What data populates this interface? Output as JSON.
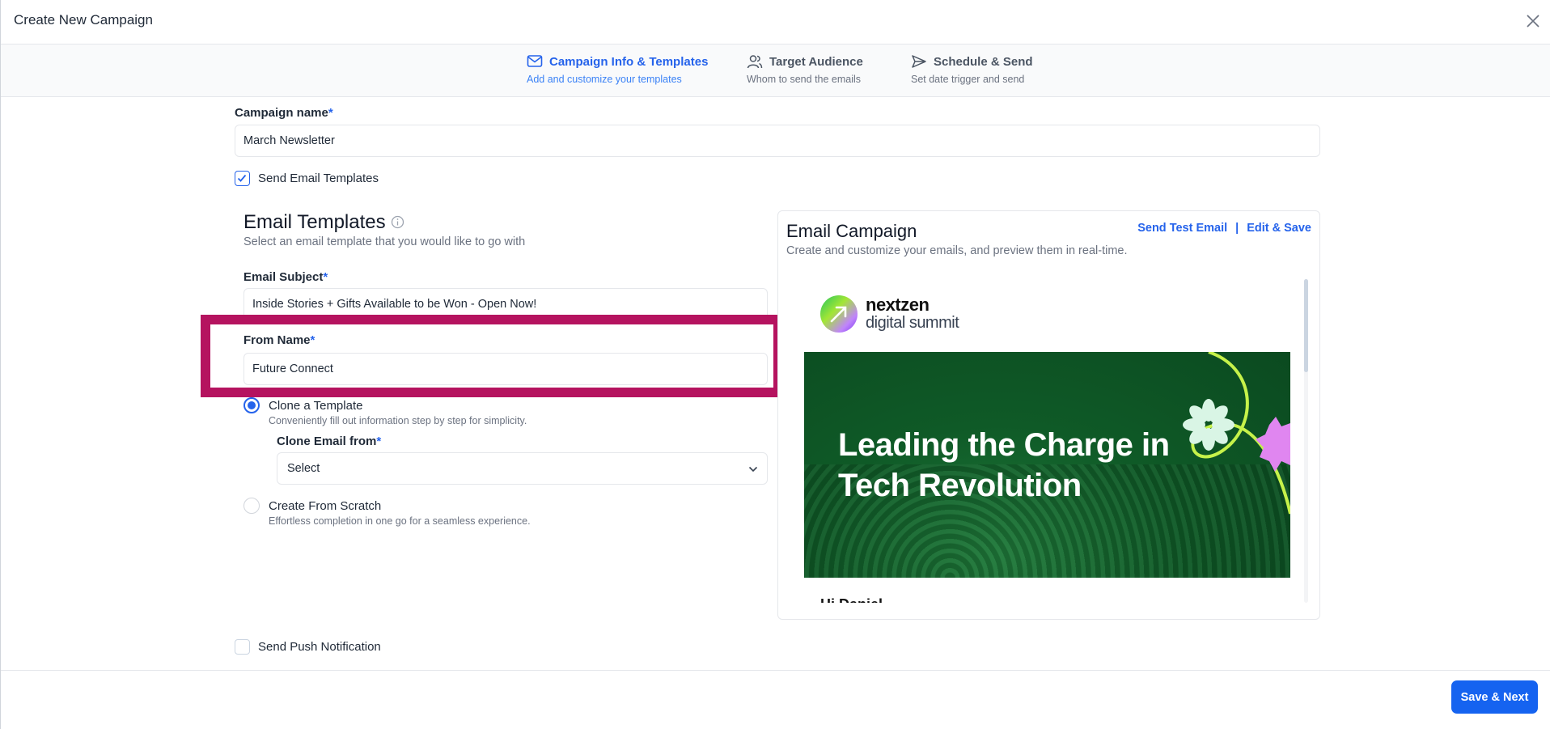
{
  "header": {
    "title": "Create New Campaign",
    "close_icon": "close-icon"
  },
  "stepper": {
    "steps": [
      {
        "title": "Campaign Info & Templates",
        "subtitle": "Add and customize your templates",
        "icon": "mail-icon",
        "active": true
      },
      {
        "title": "Target Audience",
        "subtitle": "Whom to send the emails",
        "icon": "users-icon",
        "active": false
      },
      {
        "title": "Schedule & Send",
        "subtitle": "Set date trigger and send",
        "icon": "send-icon",
        "active": false
      }
    ]
  },
  "form": {
    "campaign_name": {
      "label": "Campaign name",
      "required": "*",
      "value": "March Newsletter"
    },
    "send_email_templates": {
      "label": "Send Email Templates",
      "checked": true
    },
    "email_templates": {
      "title": "Email Templates",
      "subtitle": "Select an email template that you would like to go with",
      "info_icon": "info-icon"
    },
    "email_subject": {
      "label": "Email Subject",
      "required": "*",
      "value": "Inside Stories + Gifts Available to be Won - Open Now!"
    },
    "from_name": {
      "label": "From Name",
      "required": "*",
      "value": "Future Connect"
    },
    "clone_template": {
      "label": "Clone a Template",
      "description": "Conveniently fill out information step by step for simplicity.",
      "selected": true
    },
    "clone_email_from": {
      "label": "Clone Email from",
      "required": "*",
      "value": "Select"
    },
    "create_from_scratch": {
      "label": "Create From Scratch",
      "description": "Effortless completion in one go for a seamless experience.",
      "selected": false
    },
    "send_push_notification": {
      "label": "Send Push Notification",
      "checked": false
    }
  },
  "preview": {
    "title": "Email Campaign",
    "subtitle": "Create and customize your emails, and preview them in real-time.",
    "send_test_label": "Send Test Email",
    "separator": "|",
    "edit_save_label": "Edit & Save",
    "email": {
      "logo_line1": "nextzen",
      "logo_line2": "digital summit",
      "headline": "Leading the Charge in Tech Revolution",
      "greeting": "Hi Daniel,"
    }
  },
  "footer": {
    "save_next_label": "Save & Next"
  },
  "colors": {
    "accent": "#2563eb",
    "highlight": "#b5135f",
    "banner_green": "#0f5a27"
  }
}
